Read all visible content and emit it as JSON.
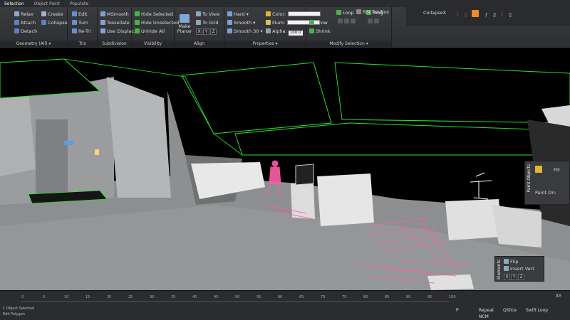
{
  "ribbon_tabs": [
    "Selection",
    "Object Paint",
    "Populate"
  ],
  "ribbon": {
    "geometry": {
      "items": [
        "Relax",
        "Create",
        "Attach",
        "Collapse",
        "Detach"
      ],
      "label": "Geometry (All) ▾"
    },
    "tris": {
      "items": [
        "Edit",
        "Turn",
        "Re-Tri"
      ],
      "label": "Tris"
    },
    "subdivision": {
      "items": [
        "MSmooth",
        "Tessellate",
        "Use Displac..."
      ],
      "label": "Subdivision"
    },
    "visibility": {
      "items": [
        "Hide Selected",
        "Hide Unselected",
        "Unhide All"
      ],
      "label": "Visibility"
    },
    "align": {
      "make_planar": "Make Planar",
      "to_view": "To View",
      "to_grid": "To Grid",
      "axes": [
        "X",
        "Y",
        "Z"
      ],
      "label": "Align"
    },
    "properties": {
      "hard": "Hard",
      "smooth": "Smooth",
      "smooth30": "Smooth 30",
      "color": "Color:",
      "illum": "Illum:",
      "alpha": "Alpha:",
      "alpha_value": "100.0",
      "label": "Properties ▾"
    },
    "modify_selection": {
      "grow": "Grow",
      "shrink": "Shrink",
      "loop": "Loop",
      "ring": "Ring",
      "label": "Modify Selection ▾"
    }
  },
  "top_right": {
    "toolbox": "RSI ToolBox",
    "collapse": "CollapseX"
  },
  "paint_panel": {
    "title": "Paint Objects",
    "paint_on": "Paint On:",
    "fill": "Fill"
  },
  "edit_panel": {
    "title": "Elements",
    "flip": "Flip",
    "insert_vert": "Insert Vert",
    "axes": [
      "X",
      "Y",
      "Z"
    ]
  },
  "status": {
    "line1": "1 Object Selected",
    "line2": "Edit Polygon",
    "ticks": [
      "0",
      "5",
      "10",
      "15",
      "20",
      "25",
      "30",
      "35",
      "40",
      "45",
      "50",
      "55",
      "60",
      "65",
      "70",
      "75",
      "80",
      "85",
      "90",
      "95",
      "100"
    ],
    "repeat": "Repeat",
    "quad_slice": "QSlice",
    "swift_loop": "Swift Loop",
    "ncm": "NCM",
    "p_label": "P",
    "x_label": "XY"
  },
  "colors": {
    "wireframe": "#29e02c",
    "selection": "#ff5fa8",
    "ribbon_accent": "#f08a24",
    "geometry": "#c9c9c9"
  }
}
